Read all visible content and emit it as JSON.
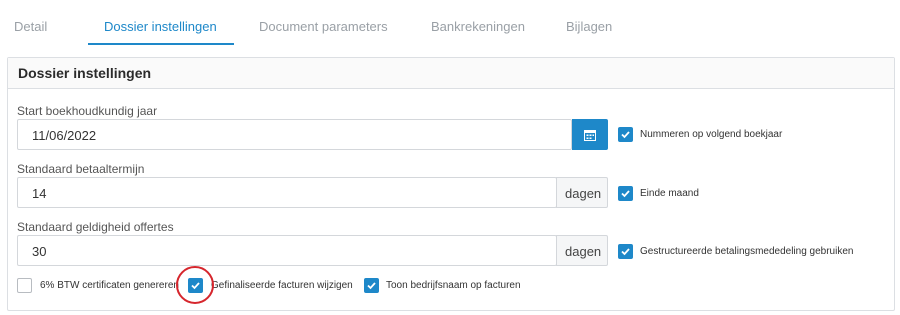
{
  "tabs": [
    {
      "label": "Detail",
      "active": false
    },
    {
      "label": "Dossier instellingen",
      "active": true
    },
    {
      "label": "Document parameters",
      "active": false
    },
    {
      "label": "Bankrekeningen",
      "active": false
    },
    {
      "label": "Bijlagen",
      "active": false
    }
  ],
  "panel": {
    "title": "Dossier instellingen"
  },
  "fields": {
    "start_year": {
      "label": "Start boekhoudkundig jaar",
      "value": "11/06/2022",
      "icon": "calendar-icon"
    },
    "payment_term": {
      "label": "Standaard betaaltermijn",
      "value": "14",
      "addon": "dagen"
    },
    "quote_validity": {
      "label": "Standaard geldigheid offertes",
      "value": "30",
      "addon": "dagen"
    }
  },
  "checkboxes": {
    "number_next_year": {
      "label": "Nummeren op volgend boekjaar",
      "checked": true
    },
    "end_of_month": {
      "label": "Einde maand",
      "checked": true
    },
    "structured_payment": {
      "label": "Gestructureerde betalingsmededeling gebruiken",
      "checked": true
    },
    "vat_certificates": {
      "label": "6% BTW certificaten genereren",
      "checked": false
    },
    "edit_finalized": {
      "label": "Gefinaliseerde facturen wijzigen",
      "checked": true
    },
    "show_company_name": {
      "label": "Toon bedrijfsnaam op facturen",
      "checked": true
    }
  },
  "colors": {
    "accent": "#1e88c9",
    "highlight_circle": "#d6262d"
  }
}
